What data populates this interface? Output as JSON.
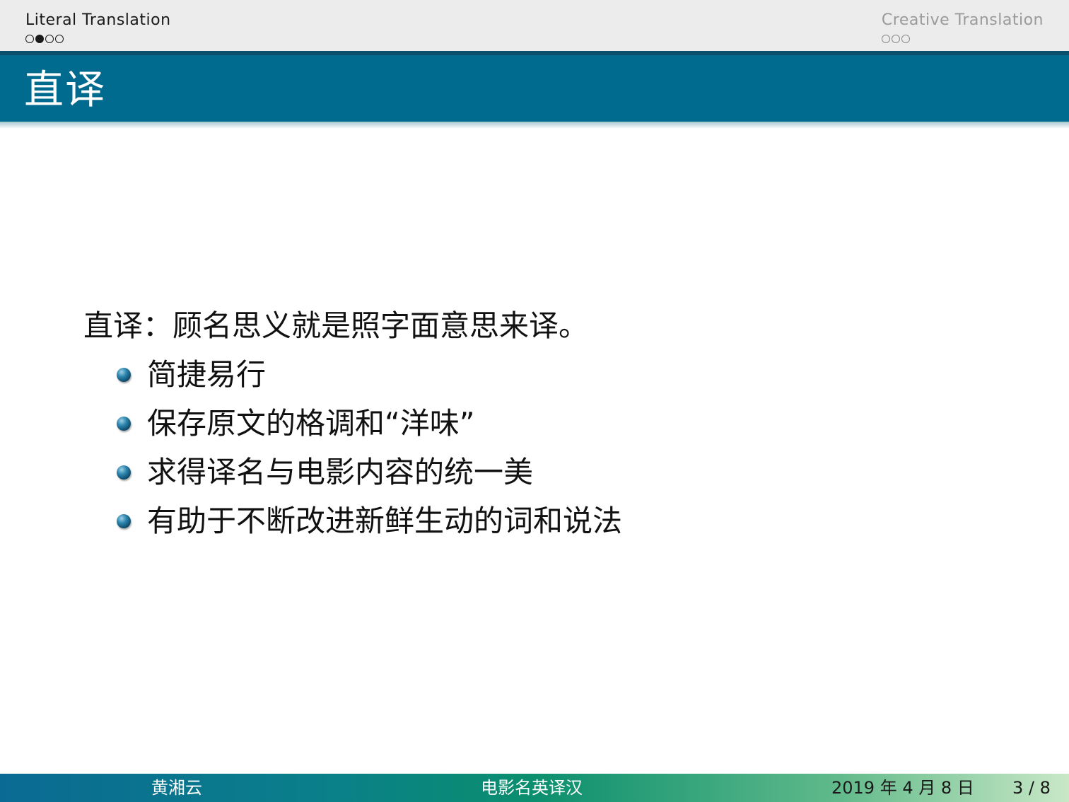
{
  "navigation": {
    "sections": [
      {
        "title": "Literal Translation",
        "active": true,
        "dots": [
          false,
          true,
          false,
          false
        ]
      },
      {
        "title": "Creative Translation",
        "active": false,
        "dots": [
          false,
          false,
          false
        ]
      }
    ]
  },
  "frame": {
    "title": "直译"
  },
  "body": {
    "lead": "直译：顾名思义就是照字面意思来译。",
    "bullets": [
      "简捷易行",
      "保存原文的格调和“洋味”",
      "求得译名与电影内容的统一美",
      "有助于不断改进新鲜生动的词和说法"
    ]
  },
  "footer": {
    "author": "黄湘云",
    "short_title": "电影名英译汉",
    "date": "2019 年 4 月 8 日",
    "page": "3 / 8"
  },
  "colors": {
    "title_bar": "#006a8f",
    "nav_bar": "#ececec",
    "text": "#111111"
  }
}
